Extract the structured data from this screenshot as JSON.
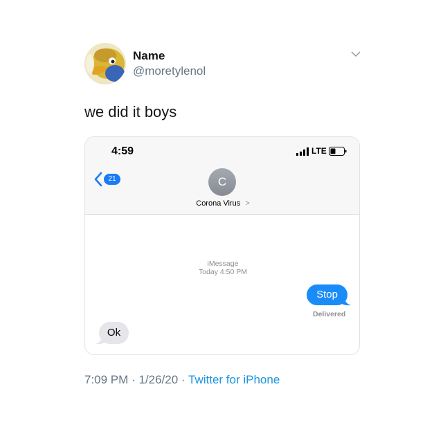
{
  "tweet": {
    "display_name": "Name",
    "handle": "@moretylenol",
    "text": "we did it boys",
    "time": "7:09 PM",
    "separator": "·",
    "date": "1/26/20",
    "source": "Twitter for iPhone",
    "menu_icon": "chevron-down-icon",
    "avatar_icon": "cartoon-duck-avatar"
  },
  "phone": {
    "status_time": "4:59",
    "network": "LTE",
    "signal_icon": "signal-bars-icon",
    "battery_icon": "battery-icon",
    "back_icon": "chevron-left-icon",
    "back_count": "21",
    "contact_initial": "C",
    "contact_name": "Corona Virus",
    "contact_chevron": ">",
    "service": "iMessage",
    "timestamp": "Today 4:50 PM",
    "messages": [
      {
        "direction": "outgoing",
        "text": "Stop",
        "status": "Delivered"
      },
      {
        "direction": "incoming",
        "text": "Ok"
      }
    ]
  },
  "colors": {
    "imessage_blue": "#1a8cf8",
    "incoming_gray": "#e5e5ea",
    "twitter_link": "#1b95e0",
    "secondary_text": "#657786"
  }
}
